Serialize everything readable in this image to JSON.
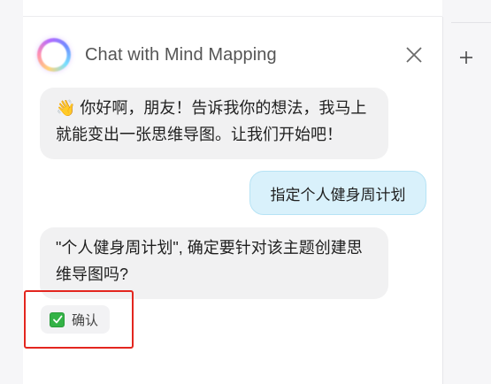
{
  "chat": {
    "title": "Chat with Mind Mapping",
    "close_label": "×",
    "new_label": "+"
  },
  "messages": [
    {
      "role": "assistant",
      "text": "👋 你好啊，朋友！告诉我你的想法，我马上就能变出一张思维导图。让我们开始吧！"
    },
    {
      "role": "user",
      "text": "指定个人健身周计划"
    },
    {
      "role": "assistant",
      "text": "\"个人健身周计划\", 确定要针对该主题创建思维导图吗?"
    }
  ],
  "actions": {
    "confirm_label": "确认"
  },
  "colors": {
    "highlight": "#e3261f",
    "user_bubble": "#d9f1fb",
    "bot_bubble": "#f1f1f2"
  }
}
